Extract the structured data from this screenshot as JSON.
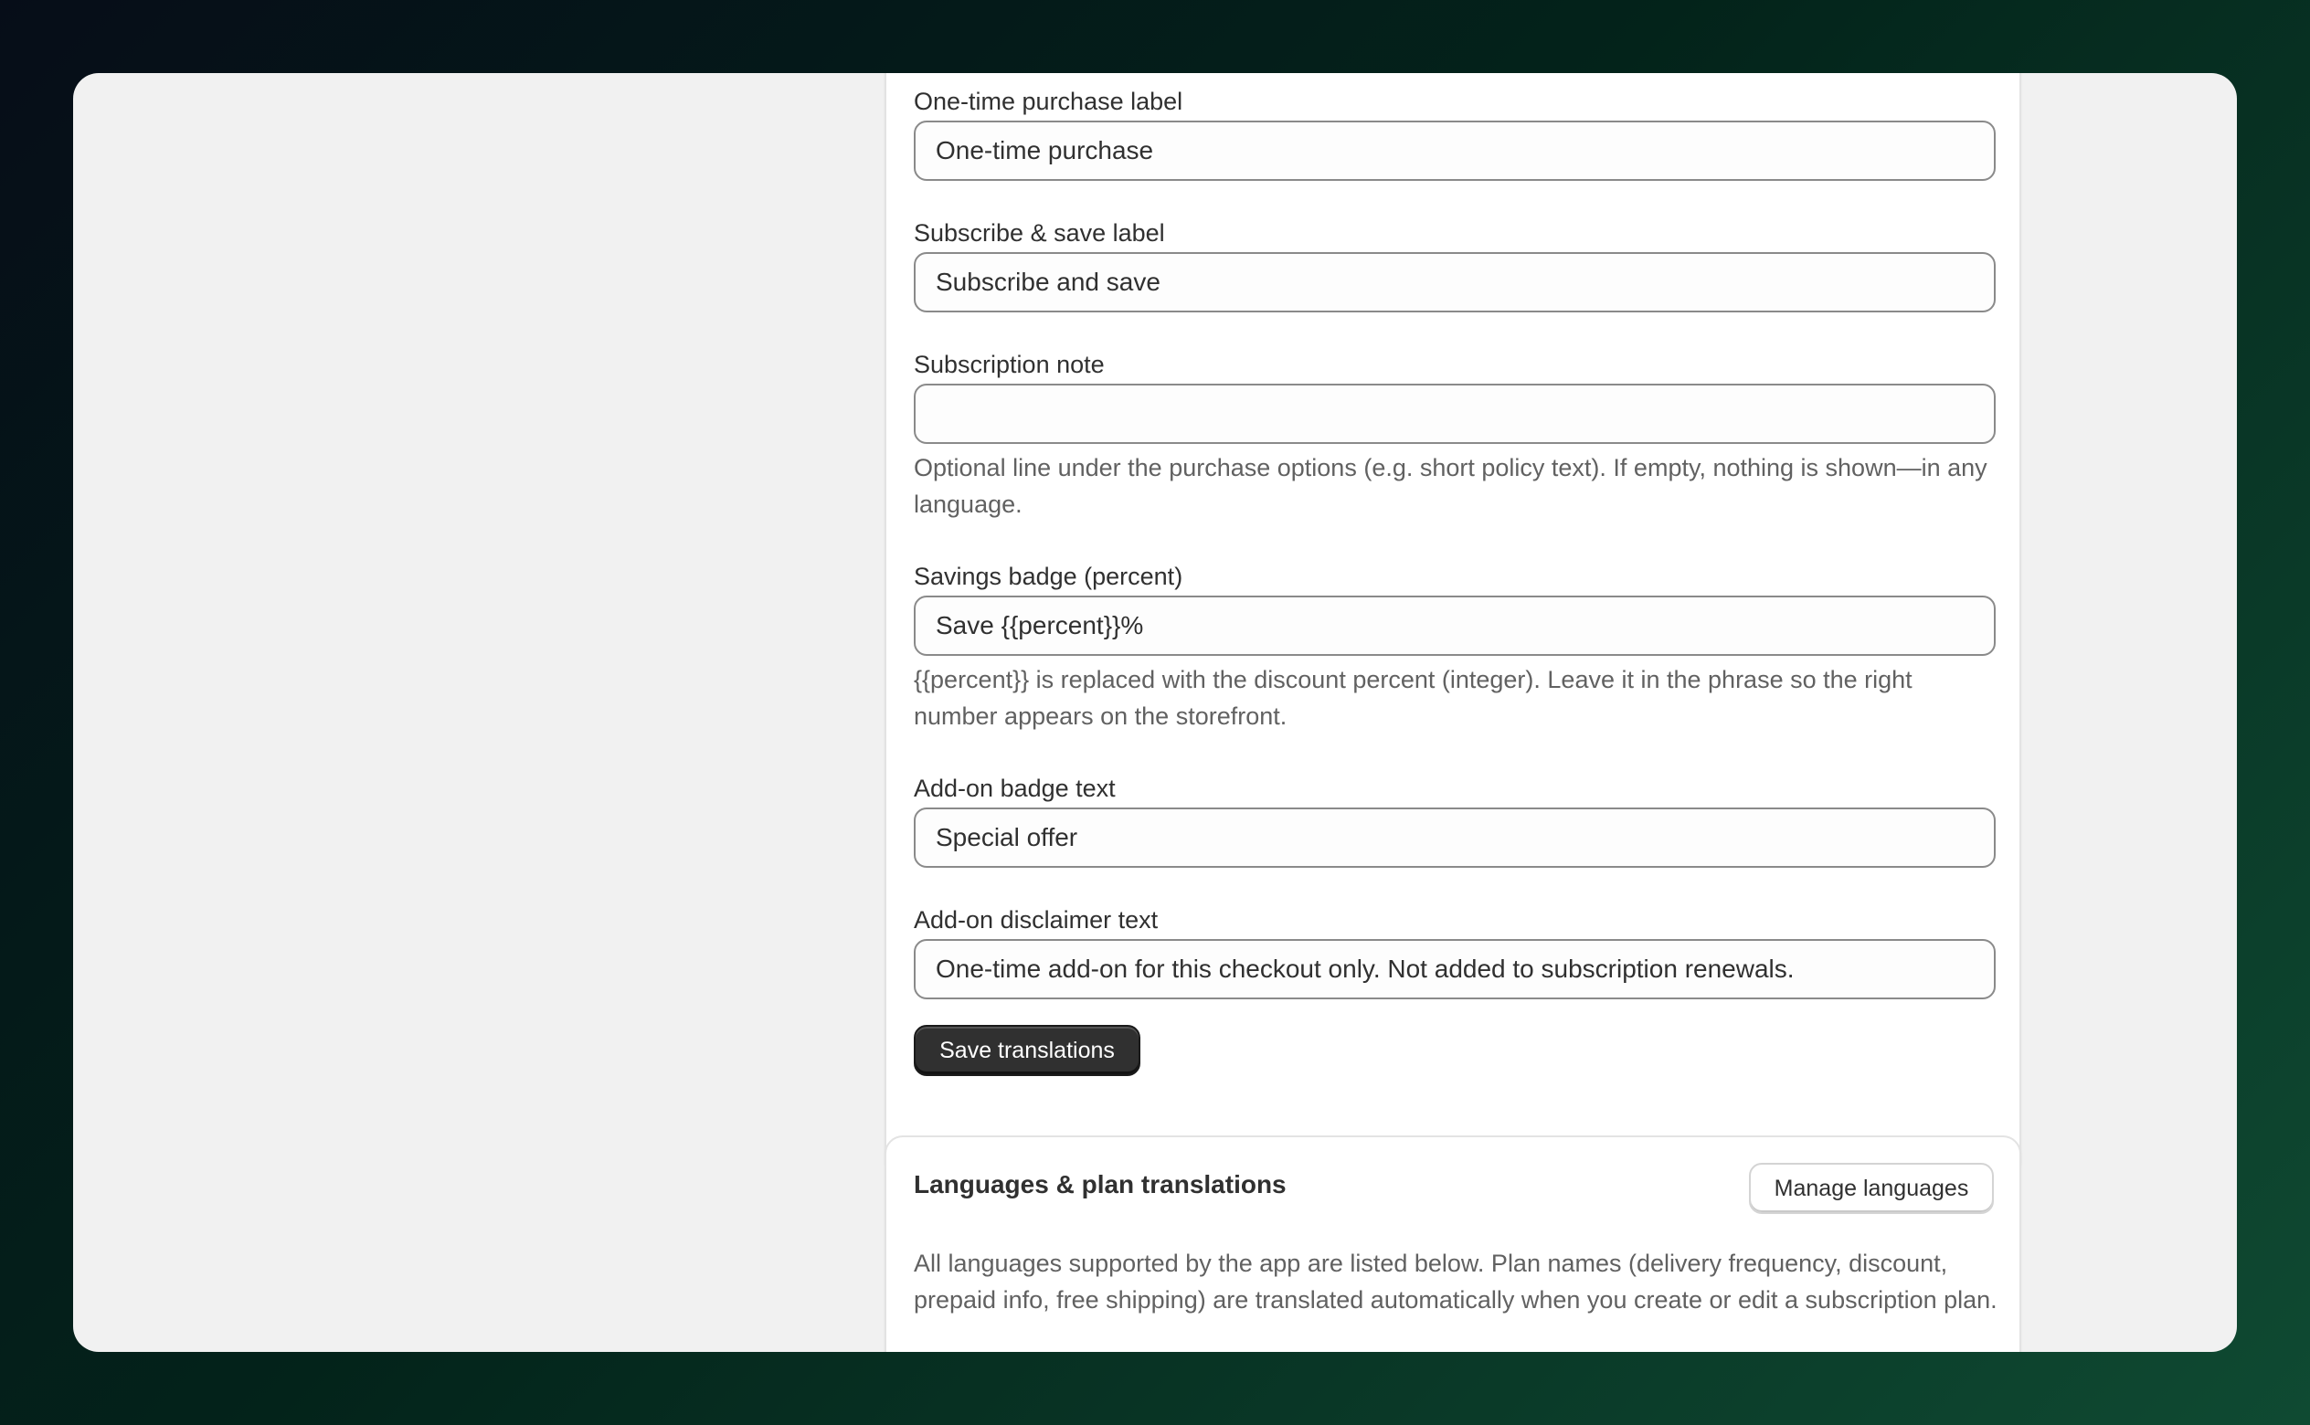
{
  "translations_form": {
    "one_time_label": {
      "label": "One-time purchase label",
      "value": "One-time purchase"
    },
    "subscribe_label": {
      "label": "Subscribe & save label",
      "value": "Subscribe and save"
    },
    "subscription_note": {
      "label": "Subscription note",
      "value": "",
      "help": "Optional line under the purchase options (e.g. short policy text). If empty, nothing is shown—in any language."
    },
    "savings_badge": {
      "label": "Savings badge (percent)",
      "value": "Save {{percent}}%",
      "help": "{{percent}} is replaced with the discount percent (integer). Leave it in the phrase so the right number appears on the storefront."
    },
    "addon_badge": {
      "label": "Add-on badge text",
      "value": "Special offer"
    },
    "addon_disclaimer": {
      "label": "Add-on disclaimer text",
      "value": "One-time add-on for this checkout only. Not added to subscription renewals."
    },
    "save_button": "Save translations"
  },
  "languages_section": {
    "title": "Languages & plan translations",
    "manage_button": "Manage languages",
    "description": "All languages supported by the app are listed below. Plan names (delivery frequency, discount, prepaid info, free shipping) are translated automatically when you create or edit a subscription plan."
  }
}
